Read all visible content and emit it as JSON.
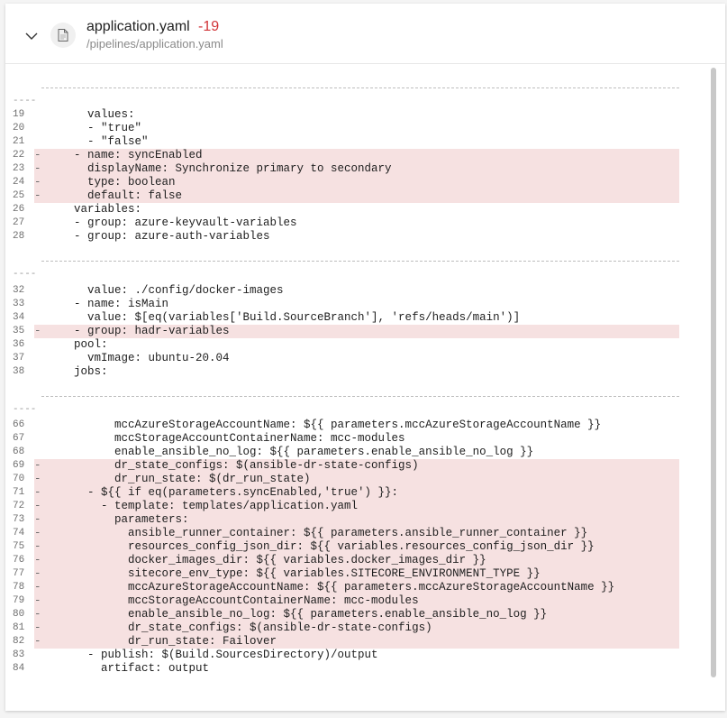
{
  "file": {
    "name": "application.yaml",
    "diff_count": "-19",
    "path": "/pipelines/application.yaml"
  },
  "separator_text": "----",
  "lines": [
    {
      "num": "19",
      "mk": "",
      "text": "    values:",
      "del": false
    },
    {
      "num": "20",
      "mk": "",
      "text": "    - \"true\"",
      "del": false
    },
    {
      "num": "21",
      "mk": "",
      "text": "    - \"false\"",
      "del": false
    },
    {
      "num": "22",
      "mk": "-",
      "text": "  - name: syncEnabled",
      "del": true
    },
    {
      "num": "23",
      "mk": "-",
      "text": "    displayName: Synchronize primary to secondary",
      "del": true
    },
    {
      "num": "24",
      "mk": "-",
      "text": "    type: boolean",
      "del": true
    },
    {
      "num": "25",
      "mk": "-",
      "text": "    default: false",
      "del": true
    },
    {
      "num": "26",
      "mk": "",
      "text": "  variables:",
      "del": false
    },
    {
      "num": "27",
      "mk": "",
      "text": "  - group: azure-keyvault-variables",
      "del": false
    },
    {
      "num": "28",
      "mk": "",
      "text": "  - group: azure-auth-variables",
      "del": false
    },
    {
      "num": "32",
      "mk": "",
      "text": "    value: ./config/docker-images",
      "del": false
    },
    {
      "num": "33",
      "mk": "",
      "text": "  - name: isMain",
      "del": false
    },
    {
      "num": "34",
      "mk": "",
      "text": "    value: $[eq(variables['Build.SourceBranch'], 'refs/heads/main')]",
      "del": false
    },
    {
      "num": "35",
      "mk": "-",
      "text": "  - group: hadr-variables",
      "del": true
    },
    {
      "num": "36",
      "mk": "",
      "text": "  pool:",
      "del": false
    },
    {
      "num": "37",
      "mk": "",
      "text": "    vmImage: ubuntu-20.04",
      "del": false
    },
    {
      "num": "38",
      "mk": "",
      "text": "  jobs:",
      "del": false
    },
    {
      "num": "66",
      "mk": "",
      "text": "        mccAzureStorageAccountName: ${{ parameters.mccAzureStorageAccountName }}",
      "del": false
    },
    {
      "num": "67",
      "mk": "",
      "text": "        mccStorageAccountContainerName: mcc-modules",
      "del": false
    },
    {
      "num": "68",
      "mk": "",
      "text": "        enable_ansible_no_log: ${{ parameters.enable_ansible_no_log }}",
      "del": false
    },
    {
      "num": "69",
      "mk": "-",
      "text": "        dr_state_configs: $(ansible-dr-state-configs)",
      "del": true
    },
    {
      "num": "70",
      "mk": "-",
      "text": "        dr_run_state: $(dr_run_state)",
      "del": true
    },
    {
      "num": "71",
      "mk": "-",
      "text": "    - ${{ if eq(parameters.syncEnabled,'true') }}:",
      "del": true
    },
    {
      "num": "72",
      "mk": "-",
      "text": "      - template: templates/application.yaml",
      "del": true
    },
    {
      "num": "73",
      "mk": "-",
      "text": "        parameters:",
      "del": true
    },
    {
      "num": "74",
      "mk": "-",
      "text": "          ansible_runner_container: ${{ parameters.ansible_runner_container }}",
      "del": true
    },
    {
      "num": "75",
      "mk": "-",
      "text": "          resources_config_json_dir: ${{ variables.resources_config_json_dir }}",
      "del": true
    },
    {
      "num": "76",
      "mk": "-",
      "text": "          docker_images_dir: ${{ variables.docker_images_dir }}",
      "del": true
    },
    {
      "num": "77",
      "mk": "-",
      "text": "          sitecore_env_type: ${{ variables.SITECORE_ENVIRONMENT_TYPE }}",
      "del": true
    },
    {
      "num": "78",
      "mk": "-",
      "text": "          mccAzureStorageAccountName: ${{ parameters.mccAzureStorageAccountName }}",
      "del": true
    },
    {
      "num": "79",
      "mk": "-",
      "text": "          mccStorageAccountContainerName: mcc-modules",
      "del": true
    },
    {
      "num": "80",
      "mk": "-",
      "text": "          enable_ansible_no_log: ${{ parameters.enable_ansible_no_log }}",
      "del": true
    },
    {
      "num": "81",
      "mk": "-",
      "text": "          dr_state_configs: $(ansible-dr-state-configs)",
      "del": true
    },
    {
      "num": "82",
      "mk": "-",
      "text": "          dr_run_state: Failover",
      "del": true
    },
    {
      "num": "83",
      "mk": "",
      "text": "    - publish: $(Build.SourcesDirectory)/output",
      "del": false
    },
    {
      "num": "84",
      "mk": "",
      "text": "      artifact: output",
      "del": false
    }
  ]
}
